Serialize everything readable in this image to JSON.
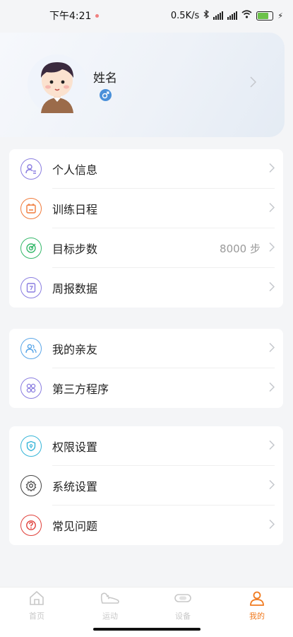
{
  "status_bar": {
    "time": "下午4:21",
    "network_speed": "0.5K/s",
    "battery_level": "80"
  },
  "profile": {
    "name": "姓名",
    "gender_icon": "male-icon"
  },
  "groups": [
    {
      "items": [
        {
          "label": "个人信息",
          "icon": "person-card-icon",
          "color": "#8a7de0"
        },
        {
          "label": "训练日程",
          "icon": "calendar-icon",
          "color": "#f07a3a"
        },
        {
          "label": "目标步数",
          "icon": "target-icon",
          "color": "#35b86a",
          "value": "8000 步"
        },
        {
          "label": "周报数据",
          "icon": "weekly-report-icon",
          "color": "#8a7de0"
        }
      ]
    },
    {
      "items": [
        {
          "label": "我的亲友",
          "icon": "friends-icon",
          "color": "#5aa6e8"
        },
        {
          "label": "第三方程序",
          "icon": "apps-icon",
          "color": "#8a7de0"
        }
      ]
    },
    {
      "items": [
        {
          "label": "权限设置",
          "icon": "shield-icon",
          "color": "#36b5d8"
        },
        {
          "label": "系统设置",
          "icon": "gear-icon",
          "color": "#444444"
        },
        {
          "label": "常见问题",
          "icon": "question-icon",
          "color": "#e0403a"
        }
      ]
    }
  ],
  "bottom_nav": [
    {
      "label": "首页",
      "icon": "home-icon",
      "active": false
    },
    {
      "label": "运动",
      "icon": "shoe-icon",
      "active": false
    },
    {
      "label": "设备",
      "icon": "band-icon",
      "active": false
    },
    {
      "label": "我的",
      "icon": "person-icon",
      "active": true
    }
  ],
  "colors": {
    "accent": "#f07a1f",
    "inactive": "#c8c8c8"
  }
}
